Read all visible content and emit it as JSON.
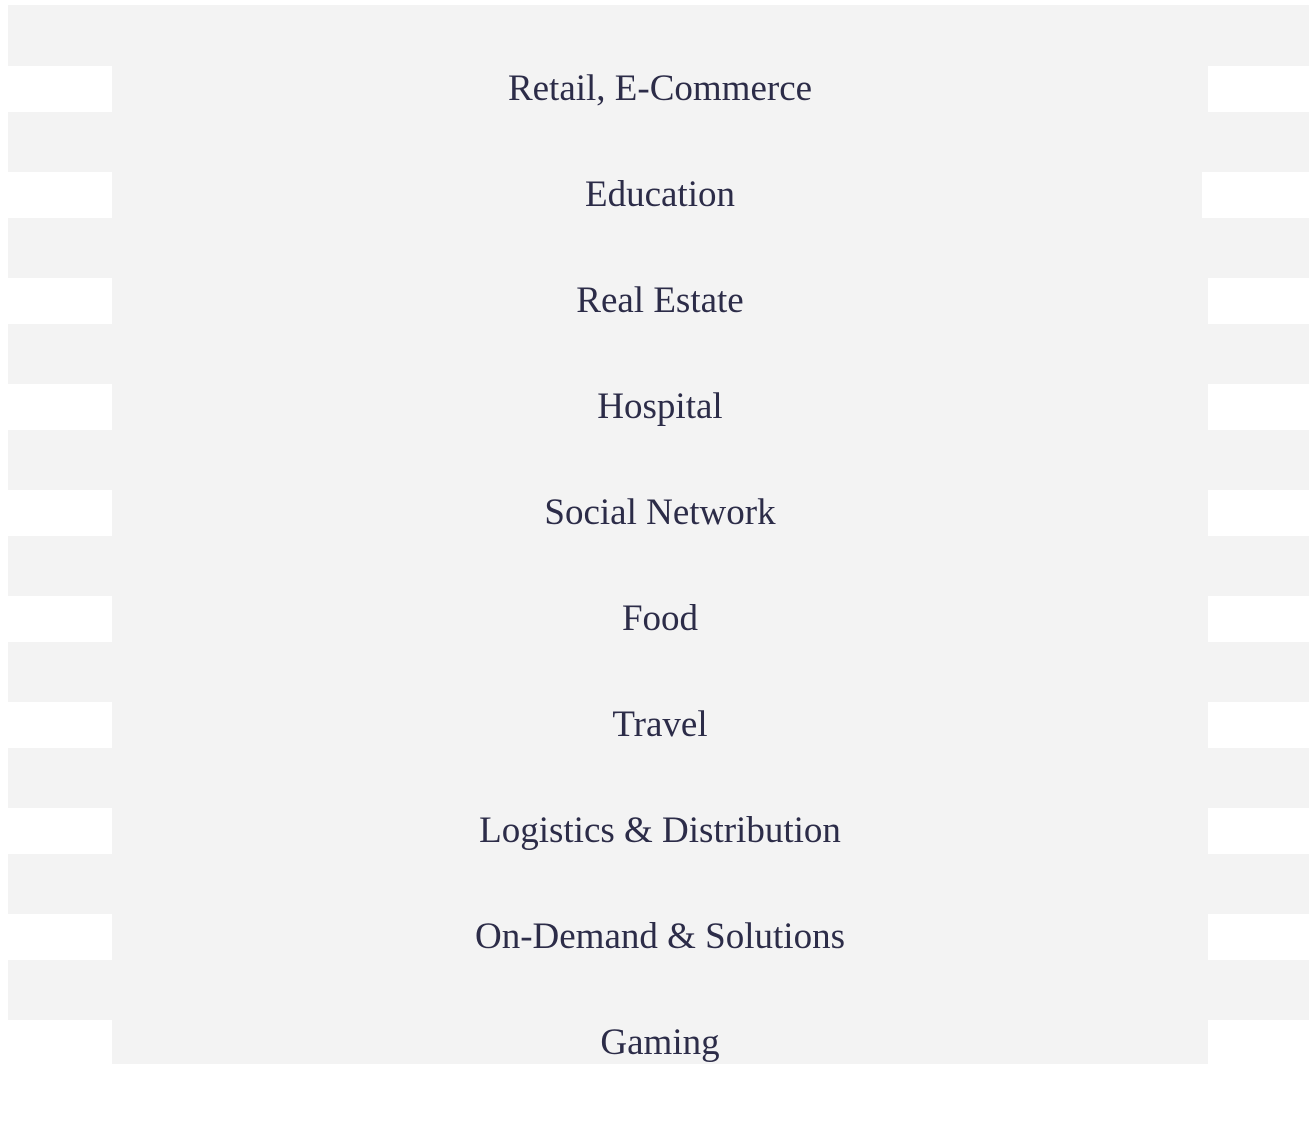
{
  "colors": {
    "panel_background": "#f3f3f3",
    "page_background": "#ffffff",
    "link_text": "#2c2c48"
  },
  "menu": {
    "items": [
      {
        "label": "Retail, E-Commerce"
      },
      {
        "label": "Education"
      },
      {
        "label": "Real Estate"
      },
      {
        "label": "Hospital"
      },
      {
        "label": "Social Network"
      },
      {
        "label": "Food"
      },
      {
        "label": "Travel"
      },
      {
        "label": "Logistics & Distribution"
      },
      {
        "label": "On-Demand & Solutions"
      },
      {
        "label": "Gaming"
      }
    ]
  }
}
